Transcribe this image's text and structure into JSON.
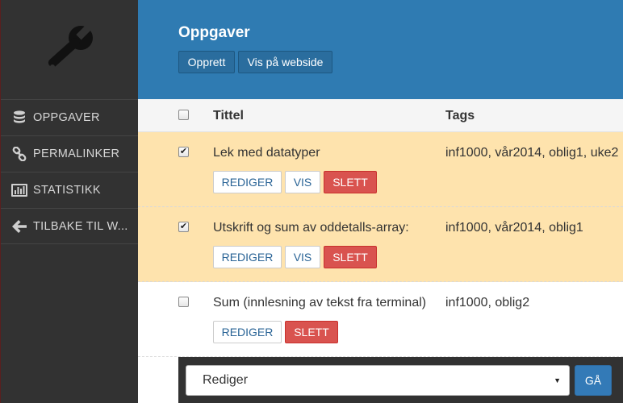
{
  "sidebar": {
    "items": [
      {
        "label": "OPPGAVER",
        "icon": "database-icon"
      },
      {
        "label": "PERMALINKER",
        "icon": "link-icon"
      },
      {
        "label": "STATISTIKK",
        "icon": "bar-chart-icon"
      },
      {
        "label": "TILBAKE TIL W...",
        "icon": "arrow-left-icon"
      }
    ]
  },
  "header": {
    "title": "Oppgaver",
    "create_label": "Opprett",
    "view_label": "Vis på webside"
  },
  "table": {
    "columns": [
      "Tittel",
      "Tags"
    ],
    "rows": [
      {
        "title": "Lek med datatyper",
        "tags": "inf1000, vår2014, oblig1, uke2",
        "checked": true,
        "edit": "REDIGER",
        "view": "VIS",
        "delete": "SLETT"
      },
      {
        "title": "Utskrift og sum av oddetalls-array:",
        "tags": "inf1000, vår2014, oblig1",
        "checked": true,
        "edit": "REDIGER",
        "view": "VIS",
        "delete": "SLETT"
      },
      {
        "title": "Sum (innlesning av tekst fra terminal)",
        "tags": "inf1000, oblig2",
        "checked": false,
        "edit": "REDIGER",
        "delete": "SLETT"
      }
    ]
  },
  "bulk": {
    "selected": "Rediger",
    "go_label": "GÅ"
  },
  "colors": {
    "sidebar_bg": "#323232",
    "header_bg": "#2f7bb2",
    "selected_row_bg": "#fee3ad",
    "danger": "#d9534f",
    "primary": "#337ab7"
  }
}
